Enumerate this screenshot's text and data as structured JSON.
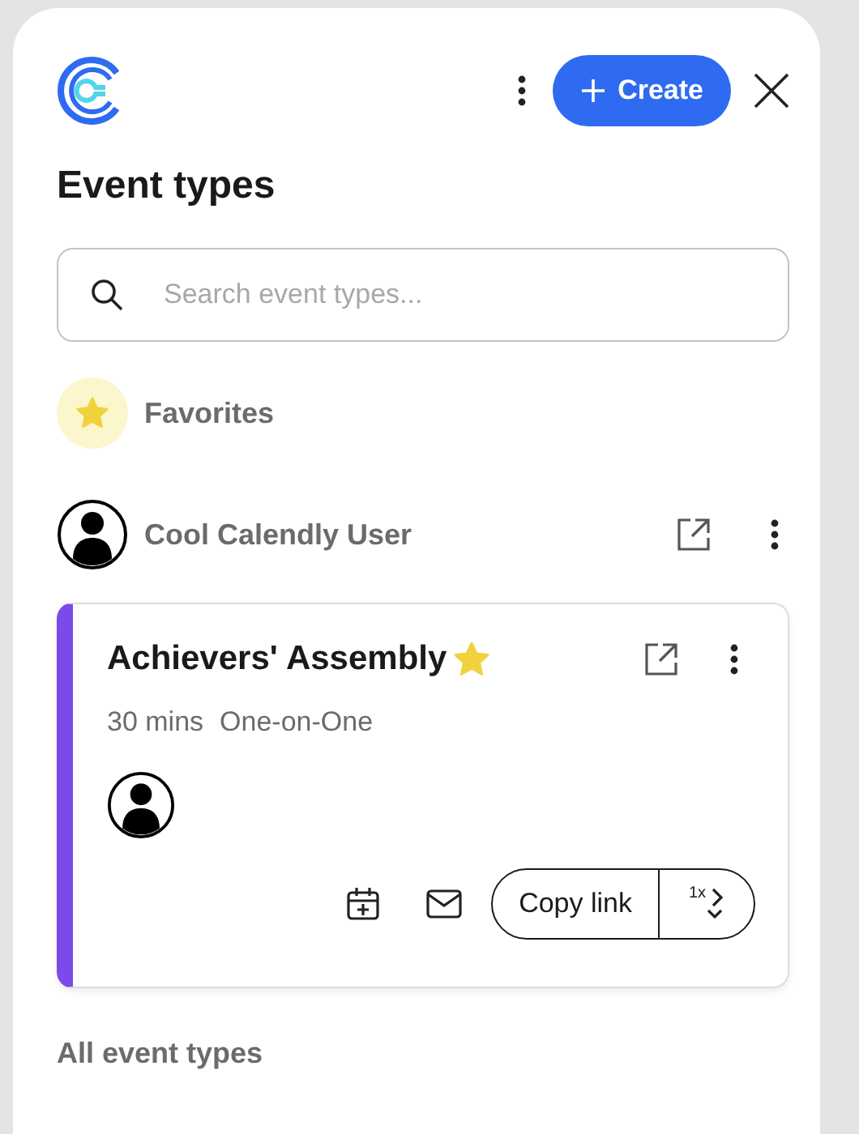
{
  "header": {
    "create_button": {
      "label": "Create"
    }
  },
  "title": "Event types",
  "search": {
    "placeholder": "Search event types..."
  },
  "favorites": {
    "label": "Favorites"
  },
  "user": {
    "name": "Cool Calendly User"
  },
  "event_cards": [
    {
      "title": "Achievers' Assembly",
      "favorite": true,
      "color": "#7b4ae8",
      "duration": "30 mins",
      "type": "One-on-One",
      "copy_button": "Copy link",
      "single_use_badge": "1x"
    }
  ],
  "all_section": {
    "label": "All event types"
  }
}
